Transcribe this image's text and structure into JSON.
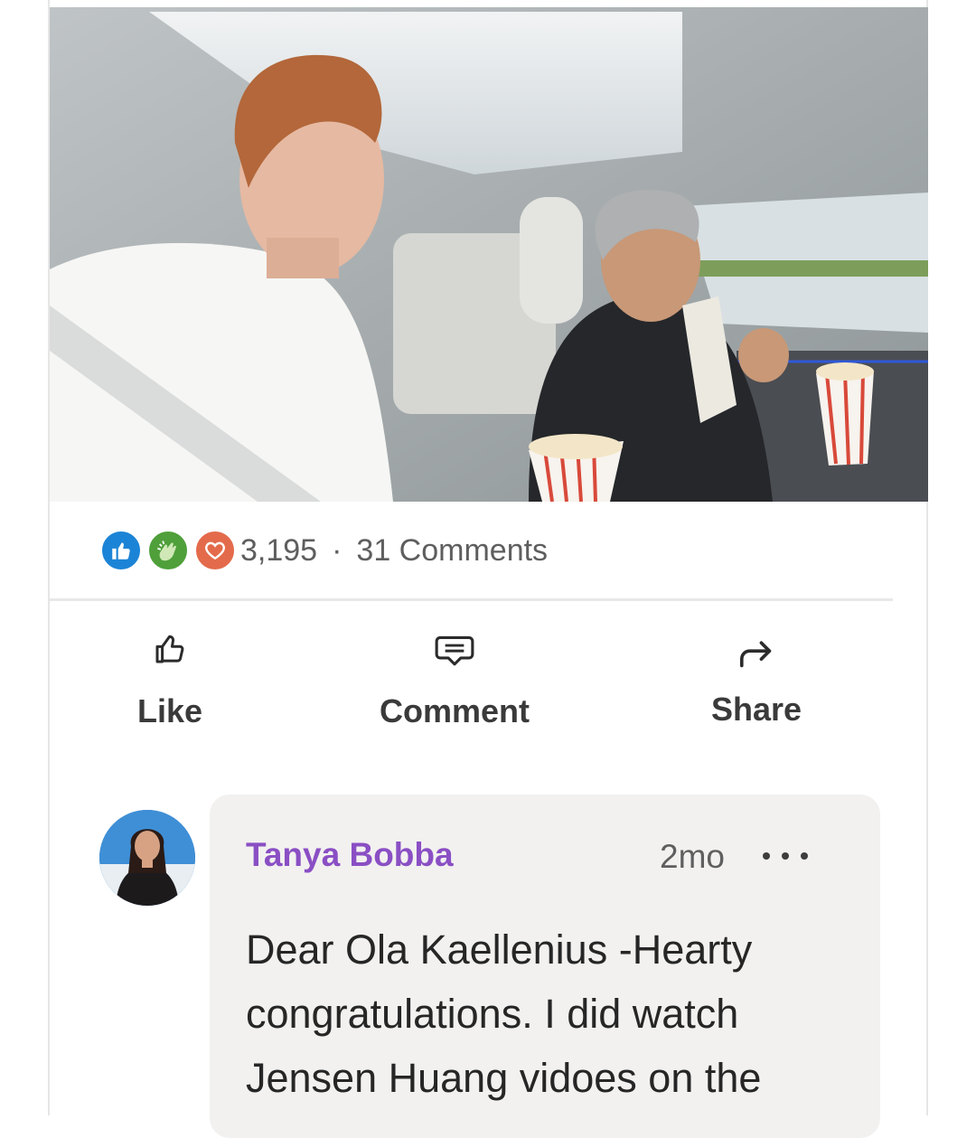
{
  "post": {
    "media_alt": "Photo of two men seated in a car holding popcorn",
    "reactions": {
      "icons": [
        "like-reaction",
        "celebrate-clap-reaction",
        "love-reaction"
      ],
      "count": "3,195",
      "separator": "·",
      "comments": "31 Comments"
    },
    "actions": {
      "like": "Like",
      "comment": "Comment",
      "share": "Share"
    }
  },
  "comment": {
    "author": "Tanya Bobba",
    "time": "2mo",
    "text": "Dear Ola Kaellenius -Hearty congratulations. I did watch Jensen Huang vidoes on the"
  },
  "colors": {
    "like_blue": "#1c84d6",
    "celebrate_green": "#4f9f3a",
    "love_orange": "#e36b4b",
    "author_purple": "#8a4fc4",
    "bubble_bg": "#f2f1f0"
  }
}
